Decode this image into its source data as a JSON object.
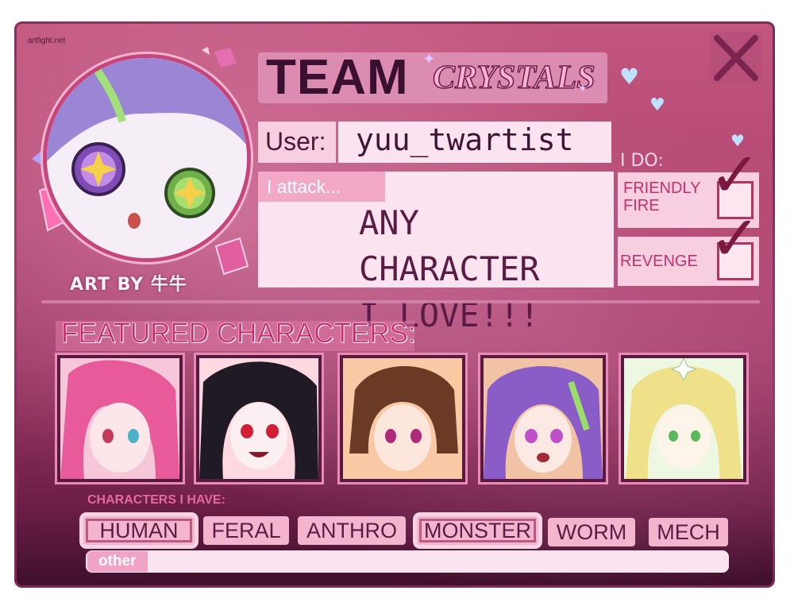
{
  "watermark": "artfight.net",
  "header": {
    "team_word": "TEAM",
    "team_name": "CRYSTALS"
  },
  "avatar": {
    "credit": "ART BY 牛牛"
  },
  "user": {
    "label": "User:",
    "value": "yuu_twartist"
  },
  "attack": {
    "label": "I attack...",
    "text": "ANY CHARACTER\nI LOVE!!!"
  },
  "i_do": {
    "title": "I DO:",
    "options": [
      {
        "label_line1": "FRIENDLY",
        "label_line2": "FIRE",
        "checked": true
      },
      {
        "label_line1": "REVENGE",
        "label_line2": "",
        "checked": true
      }
    ],
    "check_symbol": "✓"
  },
  "featured": {
    "title": "FEATURED CHARACTERS:",
    "thumbnails": [
      {
        "name": "pink-haired-character",
        "hair_color": "#e85a9a"
      },
      {
        "name": "black-haired-character",
        "hair_color": "#1f1a24"
      },
      {
        "name": "brown-haired-character",
        "hair_color": "#6b3a24"
      },
      {
        "name": "purple-haired-character",
        "hair_color": "#8a5cc8"
      },
      {
        "name": "blonde-haired-character",
        "hair_color": "#efe08a"
      }
    ]
  },
  "have": {
    "title": "CHARACTERS I HAVE:",
    "tags": [
      {
        "label": "HUMAN",
        "selected": true
      },
      {
        "label": "FERAL",
        "selected": false
      },
      {
        "label": "ANTHRO",
        "selected": false
      },
      {
        "label": "MONSTER",
        "selected": true
      },
      {
        "label": "WORM",
        "selected": false
      },
      {
        "label": "MECH",
        "selected": false
      }
    ],
    "other_label": "other",
    "other_value": ""
  },
  "colors": {
    "background": "#b14670",
    "accent": "#d22566",
    "panel": "#fbe3ef"
  }
}
